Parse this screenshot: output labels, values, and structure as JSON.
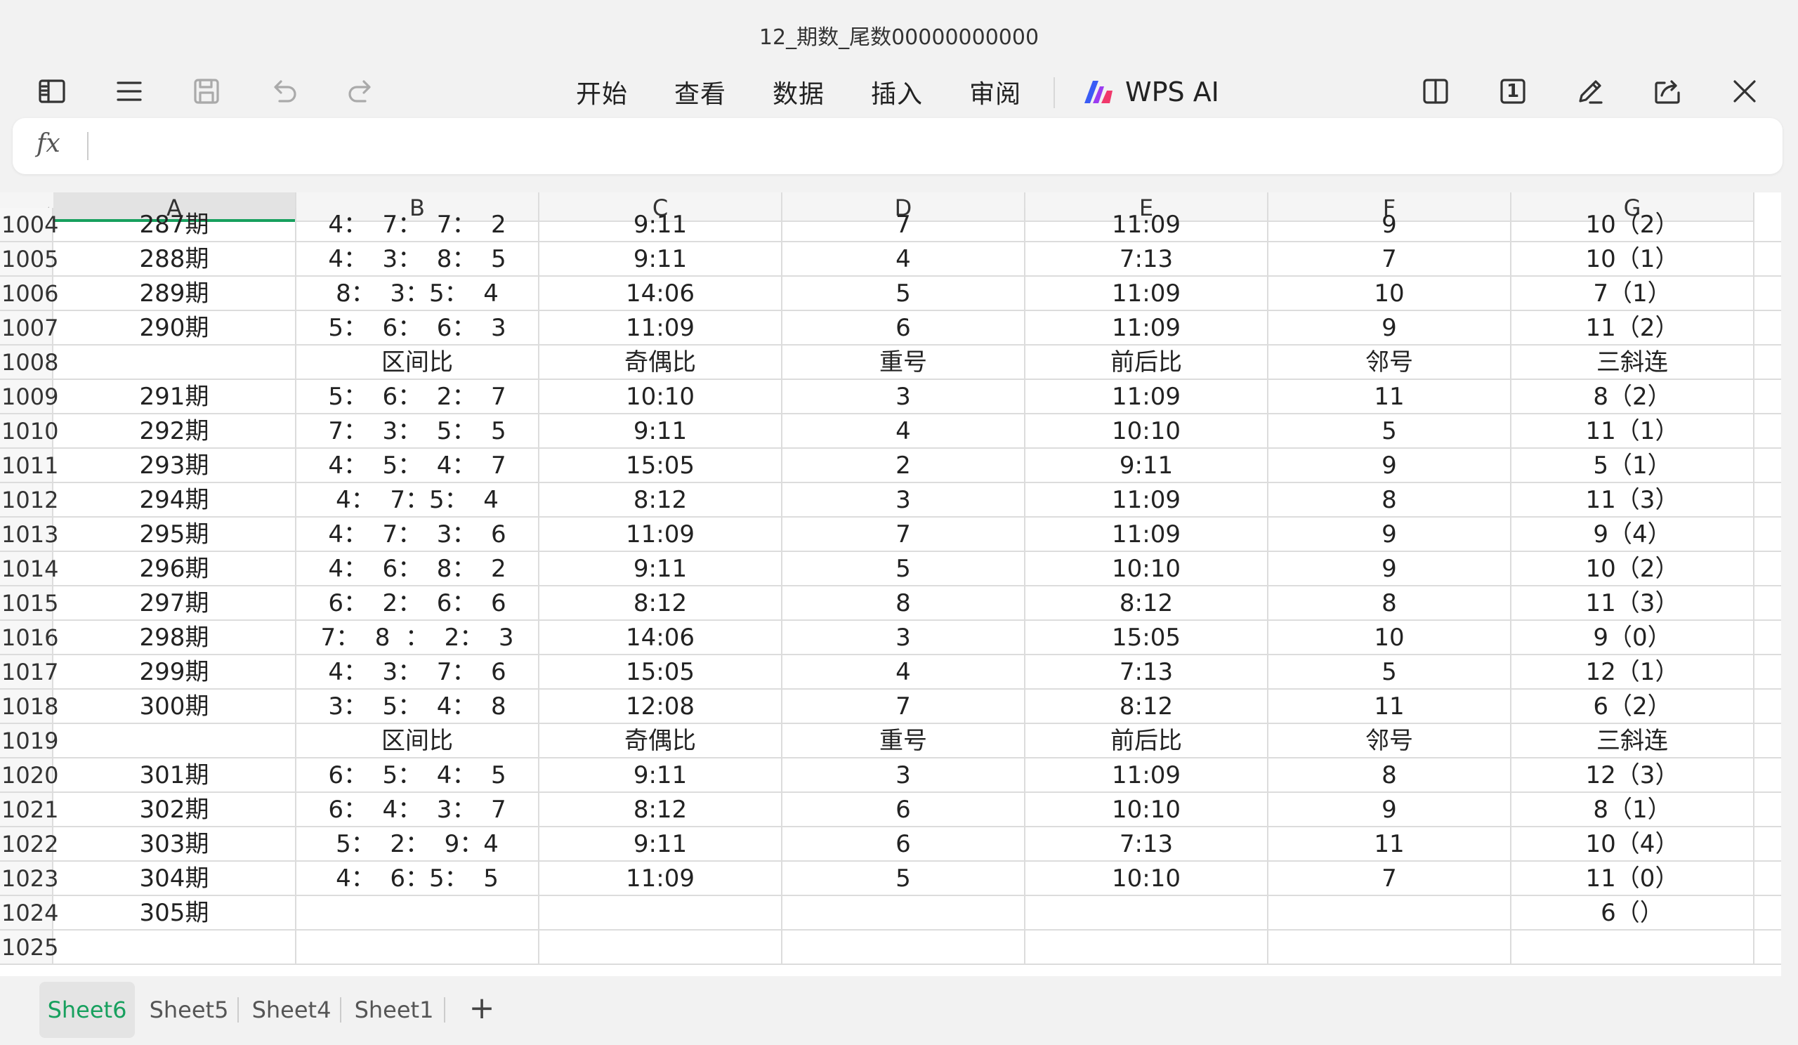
{
  "window": {
    "title": "12_期数_尾数00000000000"
  },
  "toolbar": {
    "menu": [
      "开始",
      "查看",
      "数据",
      "插入",
      "审阅"
    ],
    "ai_label": "WPS AI",
    "page_badge": "1"
  },
  "formula_bar": {
    "fx_label": "fx",
    "value": ""
  },
  "columns": [
    "A",
    "B",
    "C",
    "D",
    "E",
    "F",
    "G"
  ],
  "rows": [
    {
      "num": "1004",
      "cells": [
        "287期",
        "4：  7：  7：  2",
        "9:11",
        "7",
        "11:09",
        "9",
        "10（2）"
      ]
    },
    {
      "num": "1005",
      "cells": [
        "288期",
        "4：  3：  8：  5",
        "9:11",
        "4",
        "7:13",
        "7",
        "10（1）"
      ]
    },
    {
      "num": "1006",
      "cells": [
        "289期",
        "8：  3：5：  4",
        "14:06",
        "5",
        "11:09",
        "10",
        "7（1）"
      ]
    },
    {
      "num": "1007",
      "cells": [
        "290期",
        "5：  6：  6：  3",
        "11:09",
        "6",
        "11:09",
        "9",
        "11（2）"
      ]
    },
    {
      "num": "1008",
      "cells": [
        "",
        "区间比",
        "奇偶比",
        "重号",
        "前后比",
        "邻号",
        "三斜连"
      ]
    },
    {
      "num": "1009",
      "cells": [
        "291期",
        "5：  6：  2：  7",
        "10:10",
        "3",
        "11:09",
        "11",
        "8（2）"
      ]
    },
    {
      "num": "1010",
      "cells": [
        "292期",
        "7：  3：  5：  5",
        "9:11",
        "4",
        "10:10",
        "5",
        "11（1）"
      ]
    },
    {
      "num": "1011",
      "cells": [
        "293期",
        "4：  5：  4：  7",
        "15:05",
        "2",
        "9:11",
        "9",
        "5（1）"
      ]
    },
    {
      "num": "1012",
      "cells": [
        "294期",
        "4：  7：5：  4",
        "8:12",
        "3",
        "11:09",
        "8",
        "11（3）"
      ]
    },
    {
      "num": "1013",
      "cells": [
        "295期",
        "4：  7：  3：  6",
        "11:09",
        "7",
        "11:09",
        "9",
        "9（4）"
      ]
    },
    {
      "num": "1014",
      "cells": [
        "296期",
        "4：  6：  8：  2",
        "9:11",
        "5",
        "10:10",
        "9",
        "10（2）"
      ]
    },
    {
      "num": "1015",
      "cells": [
        "297期",
        "6：  2：  6：  6",
        "8:12",
        "8",
        "8:12",
        "8",
        "11（3）"
      ]
    },
    {
      "num": "1016",
      "cells": [
        "298期",
        "7：  8  ：  2：  3",
        "14:06",
        "3",
        "15:05",
        "10",
        "9（0）"
      ]
    },
    {
      "num": "1017",
      "cells": [
        "299期",
        "4：  3：  7：  6",
        "15:05",
        "4",
        "7:13",
        "5",
        "12（1）"
      ]
    },
    {
      "num": "1018",
      "cells": [
        "300期",
        "3：  5：  4：  8",
        "12:08",
        "7",
        "8:12",
        "11",
        "6（2）"
      ]
    },
    {
      "num": "1019",
      "cells": [
        "",
        "区间比",
        "奇偶比",
        "重号",
        "前后比",
        "邻号",
        "三斜连"
      ]
    },
    {
      "num": "1020",
      "cells": [
        "301期",
        "6：  5：  4：  5",
        "9:11",
        "3",
        "11:09",
        "8",
        "12（3）"
      ]
    },
    {
      "num": "1021",
      "cells": [
        "302期",
        "6：  4：  3：  7",
        "8:12",
        "6",
        "10:10",
        "9",
        "8（1）"
      ]
    },
    {
      "num": "1022",
      "cells": [
        "303期",
        "5：  2：  9：4",
        "9:11",
        "6",
        "7:13",
        "11",
        "10（4）"
      ]
    },
    {
      "num": "1023",
      "cells": [
        "304期",
        "4：  6：5：  5",
        "11:09",
        "5",
        "10:10",
        "7",
        "11（0）"
      ]
    },
    {
      "num": "1024",
      "cells": [
        "305期",
        "",
        "",
        "",
        "",
        "",
        "6（）"
      ]
    },
    {
      "num": "1025",
      "cells": [
        "",
        "",
        "",
        "",
        "",
        "",
        ""
      ]
    }
  ],
  "sheet_tabs": [
    "Sheet6",
    "Sheet5",
    "Sheet4",
    "Sheet1"
  ],
  "add_tab_label": "+",
  "colors": {
    "accent": "#17a05e"
  }
}
